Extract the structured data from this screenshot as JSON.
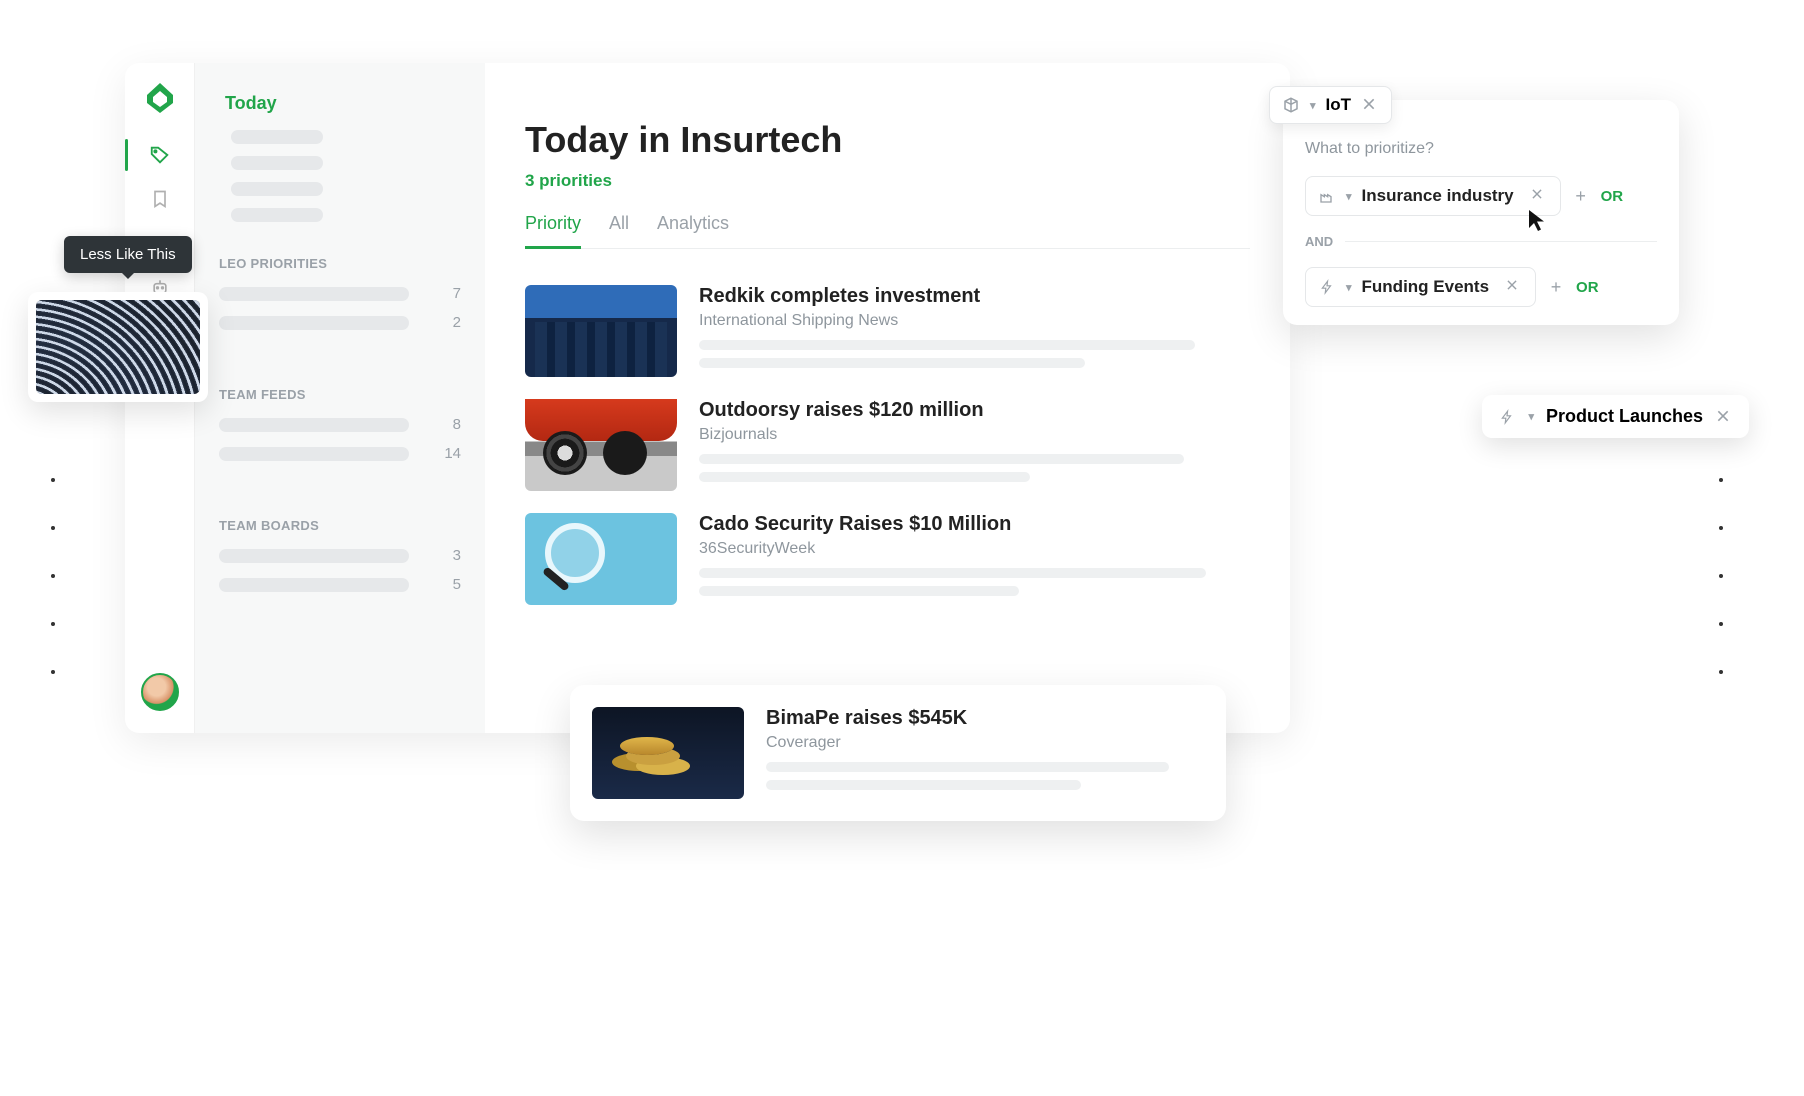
{
  "nav": {
    "active_label": "Today"
  },
  "sidebar": {
    "sections": [
      {
        "heading": "LEO PRIORITIES",
        "rows": [
          {
            "count": "7"
          },
          {
            "count": "2"
          }
        ]
      },
      {
        "heading": "TEAM FEEDS",
        "rows": [
          {
            "count": "8"
          },
          {
            "count": "14"
          }
        ]
      },
      {
        "heading": "TEAM BOARDS",
        "rows": [
          {
            "count": "3"
          },
          {
            "count": "5"
          }
        ]
      }
    ]
  },
  "main": {
    "title": "Today in Insurtech",
    "subtitle": "3 priorities",
    "tabs": {
      "priority": "Priority",
      "all": "All",
      "analytics": "Analytics"
    }
  },
  "articles": [
    {
      "title": "Redkik completes investment",
      "source": "International Shipping News"
    },
    {
      "title": "Outdoorsy raises $120 million",
      "source": "Bizjournals"
    },
    {
      "title": "Cado Security Raises $10 Million",
      "source": "36SecurityWeek"
    }
  ],
  "float_article": {
    "title": "BimaPe raises $545K",
    "source": "Coverager"
  },
  "tooltip": {
    "text": "Less Like This"
  },
  "priority_popup": {
    "seed": "IoT",
    "question": "What to prioritize?",
    "chip1": "Insurance industry",
    "and": "AND",
    "chip2": "Funding Events",
    "or": "OR"
  },
  "chip_float": {
    "label": "Product Launches"
  }
}
